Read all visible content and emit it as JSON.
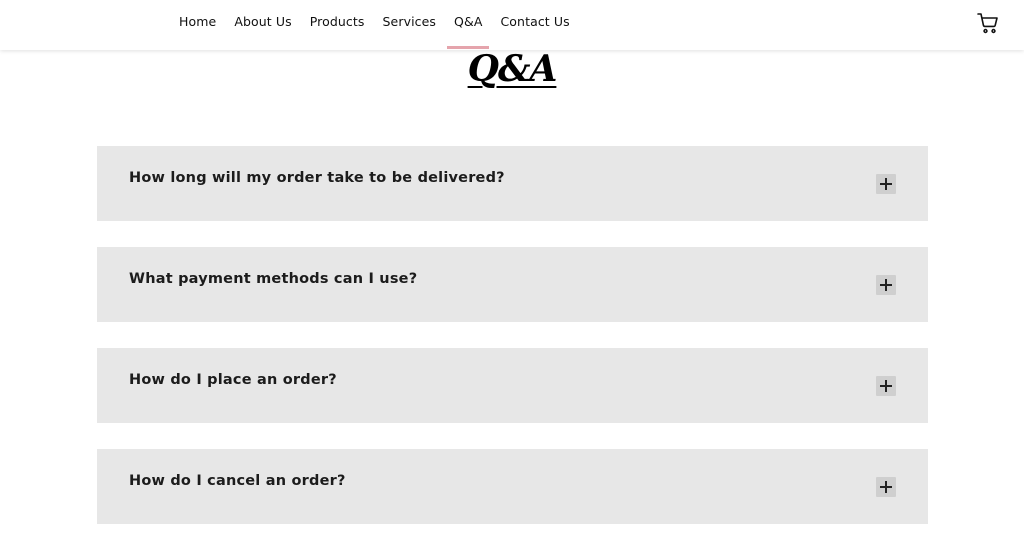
{
  "nav": {
    "items": [
      {
        "label": "Home"
      },
      {
        "label": "About Us"
      },
      {
        "label": "Products"
      },
      {
        "label": "Services"
      },
      {
        "label": "Q&A",
        "active": true
      },
      {
        "label": "Contact Us"
      }
    ],
    "cart_icon": "shopping-cart-icon",
    "active_color": "#e5a4ac"
  },
  "page": {
    "title": "Q&A"
  },
  "faq": {
    "toggle_icon": "plus-icon",
    "items": [
      {
        "question": "How long will my order take to be delivered?"
      },
      {
        "question": "What payment methods can I use?"
      },
      {
        "question": "How do I place an order?"
      },
      {
        "question": "How do I cancel an order?"
      }
    ]
  }
}
